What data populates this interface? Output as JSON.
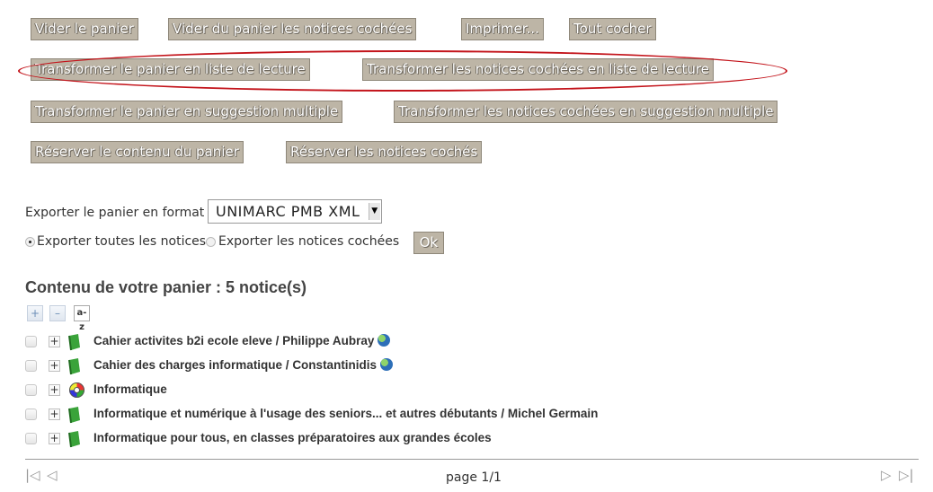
{
  "buttons": {
    "vider_panier": "Vider le panier",
    "vider_cochees": "Vider du panier les notices cochées",
    "imprimer": "Imprimer...",
    "tout_cocher": "Tout cocher",
    "liste_lecture_panier": "Transformer le panier en liste de lecture",
    "liste_lecture_cochees": "Transformer les notices cochées en liste de lecture",
    "suggestion_panier": "Transformer le panier en suggestion multiple",
    "suggestion_cochees": "Transformer les notices cochées en suggestion multiple",
    "reserver_panier": "Réserver le contenu du panier",
    "reserver_cochees": "Réserver les notices cochés"
  },
  "export": {
    "label": "Exporter le panier en format :",
    "format_selected": "UNIMARC PMB XML",
    "option_all": "Exporter toutes les notices",
    "option_checked": "Exporter les notices cochées",
    "ok_label": "Ok"
  },
  "basket": {
    "heading": "Contenu de votre panier : 5 notice(s)",
    "sort_label": "a-z",
    "items": [
      {
        "title": "Cahier activites b2i ecole eleve / Philippe Aubray",
        "icon": "book-icon",
        "online": true
      },
      {
        "title": "Cahier des charges informatique / Constantinidis",
        "icon": "book-icon",
        "online": true
      },
      {
        "title": "Informatique",
        "icon": "cd-icon",
        "online": false
      },
      {
        "title": "Informatique et numérique à l'usage des seniors... et autres débutants / Michel Germain",
        "icon": "book-icon",
        "online": false
      },
      {
        "title": "Informatique pour tous, en classes préparatoires aux grandes écoles",
        "icon": "book-icon",
        "online": false
      }
    ]
  },
  "pagination": {
    "label": "page 1/1",
    "first": "|◁",
    "prev": "◁",
    "next": "▷",
    "last": "▷|"
  },
  "colors": {
    "button_bg": "#bdb5a6",
    "highlight_ellipse": "#c3141b"
  }
}
